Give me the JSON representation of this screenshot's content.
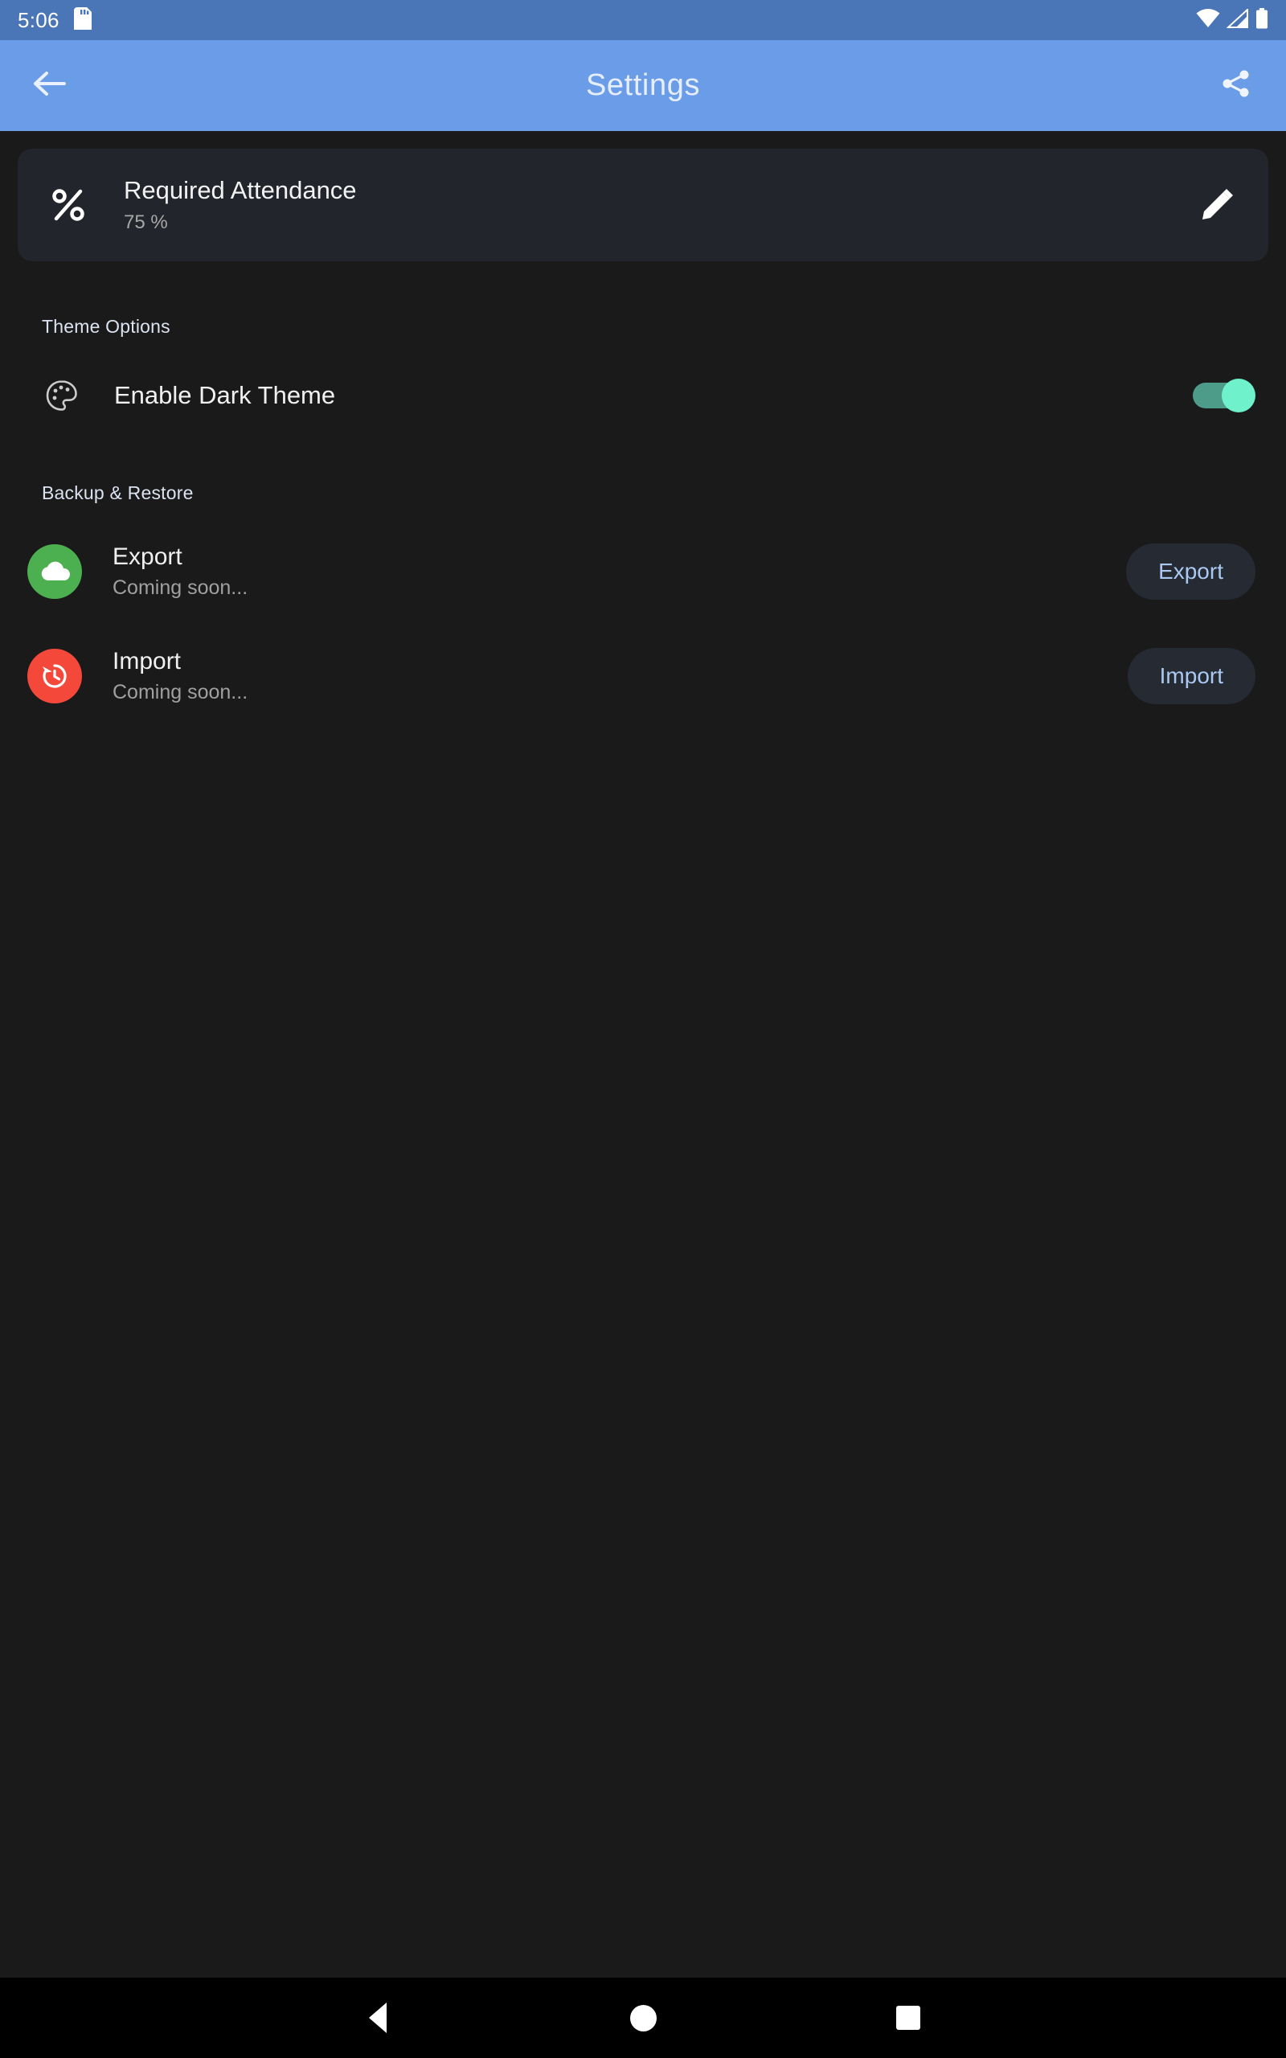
{
  "status_bar": {
    "time": "5:06",
    "icons": [
      "sd-card-icon",
      "wifi-icon",
      "cellular-signal-icon",
      "battery-icon"
    ]
  },
  "app_bar": {
    "title": "Settings",
    "back_icon": "back-arrow-icon",
    "share_icon": "share-icon",
    "background_color": "#6a9ce8"
  },
  "attendance_card": {
    "icon": "percent-icon",
    "title": "Required Attendance",
    "value": "75 %",
    "edit_icon": "pencil-edit-icon",
    "background_color": "#22252b"
  },
  "theme_section": {
    "header": "Theme Options",
    "item": {
      "icon": "palette-icon",
      "label": "Enable Dark Theme",
      "toggle_on": true,
      "toggle_track_color": "#4d9c8a",
      "toggle_thumb_color": "#6ff2cb"
    }
  },
  "backup_section": {
    "header": "Backup & Restore",
    "items": [
      {
        "icon": "cloud-upload-icon",
        "icon_bg": "#4caf50",
        "title": "Export",
        "subtitle": "Coming soon...",
        "button_label": "Export"
      },
      {
        "icon": "restore-history-icon",
        "icon_bg": "#f4483a",
        "title": "Import",
        "subtitle": "Coming soon...",
        "button_label": "Import"
      }
    ],
    "button_text_color": "#a9c9f2",
    "button_bg_color": "#262a33"
  },
  "nav_bar": {
    "back": "nav-back-icon",
    "home": "nav-home-icon",
    "recents": "nav-recents-icon"
  },
  "page_background": "#1a1a1a"
}
